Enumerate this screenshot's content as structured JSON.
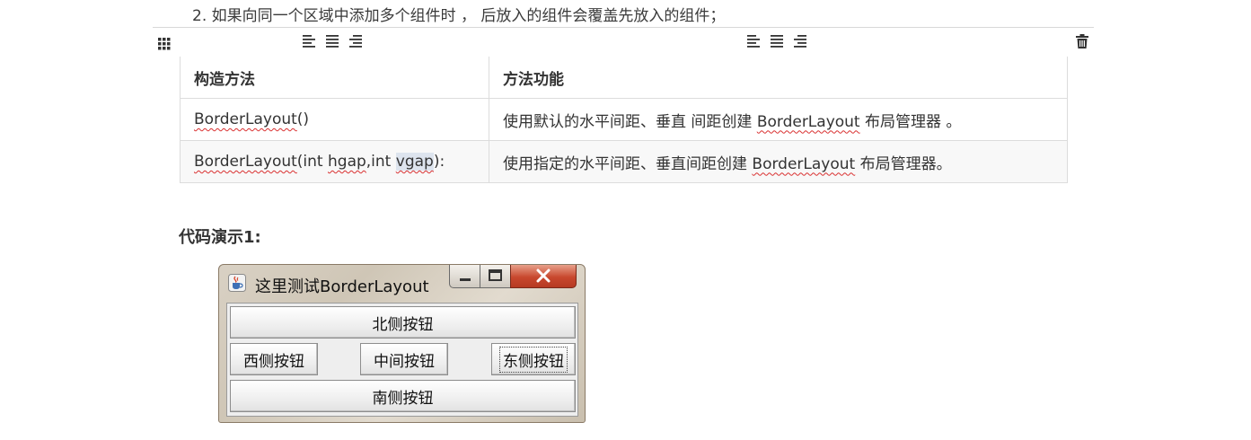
{
  "intro_text": "2. 如果向同一个区域中添加多个组件时 ， 后放入的组件会覆盖先放入的组件；",
  "toolbar": {
    "grip_icon": "grid-drag-icon",
    "align_icons": [
      "align-left-icon",
      "align-center-icon",
      "align-right-icon"
    ],
    "delete_icon": "trash-icon"
  },
  "table": {
    "headers": [
      "构造方法",
      "方法功能"
    ],
    "rows": [
      {
        "method_parts": [
          "BorderLayout",
          "()"
        ],
        "desc_parts": [
          "使用默认的水平间距、垂直 间距创建 ",
          "BorderLayout",
          " 布局管理器 。"
        ]
      },
      {
        "method_parts": [
          "BorderLayout",
          "(int ",
          "hgap",
          ",int ",
          "vgap",
          "):"
        ],
        "desc_parts": [
          "使用指定的水平间距、垂直间距创建 ",
          "BorderLayout",
          " 布局管理器。"
        ]
      }
    ]
  },
  "subtitle": "代码演示1:",
  "window": {
    "title": "这里测试BorderLayout",
    "buttons": {
      "north": "北侧按钮",
      "west": "西侧按钮",
      "center": "中间按钮",
      "east": "东侧按钮",
      "south": "南侧按钮"
    },
    "controls": [
      "minimize-icon",
      "maximize-icon",
      "close-icon"
    ]
  }
}
